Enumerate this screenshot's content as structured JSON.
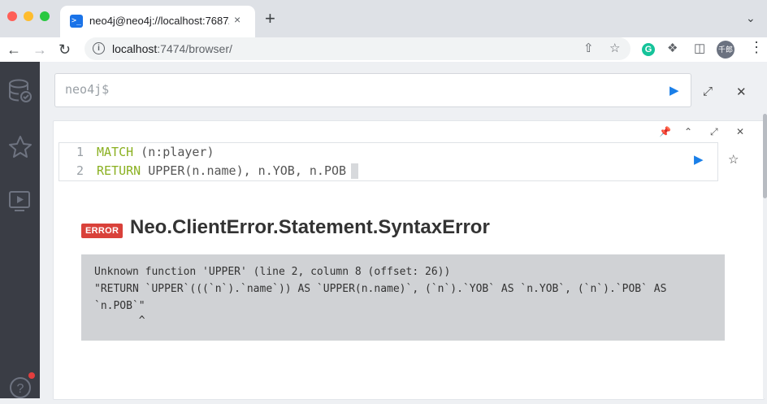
{
  "browser": {
    "tab_title": "neo4j@neo4j://localhost:7687/",
    "tab_close": "×",
    "new_tab": "+",
    "url_host": "localhost",
    "url_path": ":7474/browser/",
    "profile_label": "千郎",
    "grammarly_label": "G",
    "colors": {
      "titlebar": "#dee1e6",
      "accent": "#1a73e8"
    }
  },
  "editor": {
    "placeholder": "neo4j$"
  },
  "frame": {
    "query_lines": [
      {
        "num": "1",
        "keyword": "MATCH",
        "rest": " (n:player)"
      },
      {
        "num": "2",
        "keyword": "RETURN",
        "rest": " UPPER(n.name), n.YOB, n.POB"
      }
    ],
    "error_badge": "ERROR",
    "error_title": "Neo.ClientError.Statement.SyntaxError",
    "error_lines": [
      "Unknown function 'UPPER' (line 2, column 8 (offset: 26))",
      "\"RETURN `UPPER`(((`n`).`name`)) AS `UPPER(n.name)`, (`n`).`YOB` AS `n.YOB`, (`n`).`POB` AS",
      "`n.POB`\"",
      "       ^"
    ],
    "colors": {
      "keyword": "#8ab020",
      "error": "#d9413a",
      "run": "#1a7fe8"
    }
  }
}
